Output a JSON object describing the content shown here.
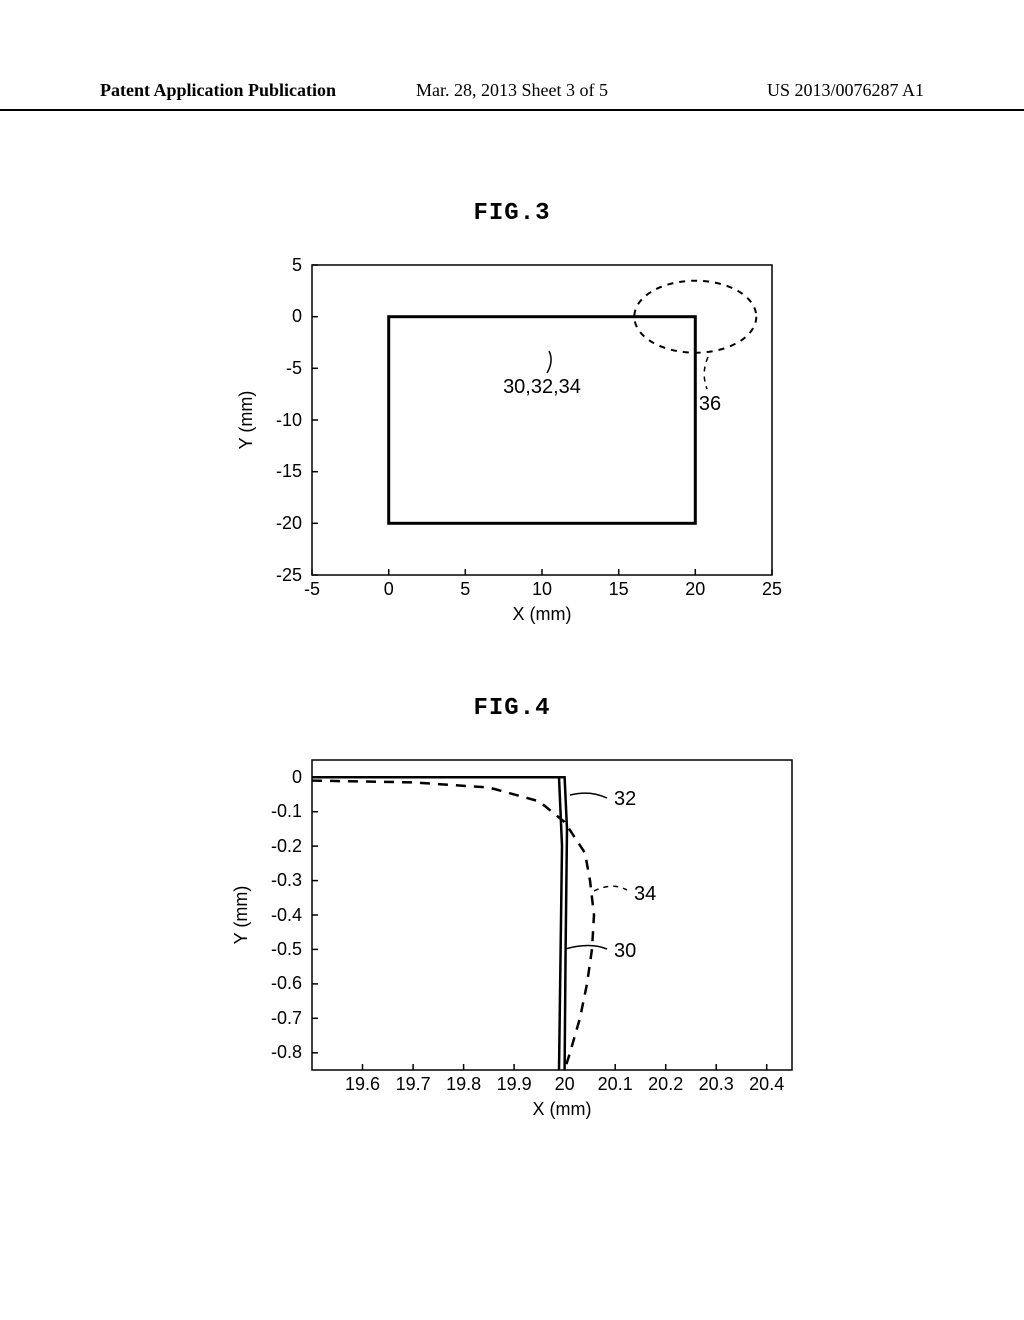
{
  "header": {
    "left": "Patent Application Publication",
    "center": "Mar. 28, 2013  Sheet 3 of 5",
    "right": "US 2013/0076287 A1"
  },
  "fig3": {
    "title": "FIG.3",
    "xlabel": "X (mm)",
    "ylabel": "Y (mm)",
    "xticks": [
      "-5",
      "0",
      "5",
      "10",
      "15",
      "20",
      "25"
    ],
    "yticks": [
      "5",
      "0",
      "-5",
      "-10",
      "-15",
      "-20",
      "-25"
    ],
    "annotation_30_32_34": "30,32,34",
    "annotation_36": "36"
  },
  "fig4": {
    "title": "FIG.4",
    "xlabel": "X (mm)",
    "ylabel": "Y (mm)",
    "xticks": [
      "19.6",
      "19.7",
      "19.8",
      "19.9",
      "20",
      "20.1",
      "20.2",
      "20.3",
      "20.4"
    ],
    "yticks": [
      "0",
      "-0.1",
      "-0.2",
      "-0.3",
      "-0.4",
      "-0.5",
      "-0.6",
      "-0.7",
      "-0.8"
    ],
    "annotation_32": "32",
    "annotation_34": "34",
    "annotation_30": "30"
  },
  "chart_data": [
    {
      "type": "line",
      "title": "FIG.3",
      "xlabel": "X (mm)",
      "ylabel": "Y (mm)",
      "xlim": [
        -5,
        25
      ],
      "ylim": [
        -25,
        5
      ],
      "xticks": [
        -5,
        0,
        5,
        10,
        15,
        20,
        25
      ],
      "yticks": [
        -25,
        -20,
        -15,
        -10,
        -5,
        0,
        5
      ],
      "series": [
        {
          "name": "30,32,34",
          "style": "solid",
          "points": [
            [
              0,
              0
            ],
            [
              20,
              0
            ],
            [
              20,
              -20
            ],
            [
              0,
              -20
            ],
            [
              0,
              0
            ]
          ]
        },
        {
          "name": "36",
          "style": "dashed-ellipse",
          "center": [
            20,
            0
          ],
          "rx": 4.0,
          "ry": 3.5
        }
      ],
      "annotations": [
        {
          "text": "30,32,34",
          "x": 10,
          "y": -5,
          "leader_to": [
            10.5,
            -2
          ]
        },
        {
          "text": "36",
          "x": 21,
          "y": -8,
          "leader_to": [
            21,
            -4
          ]
        }
      ]
    },
    {
      "type": "line",
      "title": "FIG.4",
      "xlabel": "X (mm)",
      "ylabel": "Y (mm)",
      "xlim": [
        19.5,
        20.45
      ],
      "ylim": [
        -0.85,
        0.05
      ],
      "xticks": [
        19.6,
        19.7,
        19.8,
        19.9,
        20,
        20.1,
        20.2,
        20.3,
        20.4
      ],
      "yticks": [
        0,
        -0.1,
        -0.2,
        -0.3,
        -0.4,
        -0.5,
        -0.6,
        -0.7,
        -0.8
      ],
      "series": [
        {
          "name": "30",
          "style": "solid",
          "points": [
            [
              19.5,
              0
            ],
            [
              19.99,
              0
            ],
            [
              19.995,
              -0.2
            ],
            [
              19.99,
              -0.85
            ]
          ]
        },
        {
          "name": "32",
          "style": "solid",
          "points": [
            [
              19.5,
              0
            ],
            [
              20.0,
              0
            ],
            [
              20.005,
              -0.15
            ],
            [
              20.002,
              -0.5
            ],
            [
              20.0,
              -0.85
            ]
          ]
        },
        {
          "name": "34",
          "style": "dashed",
          "points": [
            [
              19.5,
              -0.01
            ],
            [
              19.7,
              -0.015
            ],
            [
              19.85,
              -0.03
            ],
            [
              19.95,
              -0.07
            ],
            [
              20.0,
              -0.13
            ],
            [
              20.04,
              -0.22
            ],
            [
              20.05,
              -0.3
            ],
            [
              20.058,
              -0.4
            ],
            [
              20.055,
              -0.5
            ],
            [
              20.045,
              -0.6
            ],
            [
              20.03,
              -0.7
            ],
            [
              20.01,
              -0.8
            ],
            [
              20.0,
              -0.85
            ]
          ]
        }
      ],
      "annotations": [
        {
          "text": "32",
          "x": 20.12,
          "y": -0.07,
          "leader_to": [
            20.01,
            -0.05
          ]
        },
        {
          "text": "34",
          "x": 20.16,
          "y": -0.35,
          "leader_to": [
            20.055,
            -0.33
          ]
        },
        {
          "text": "30",
          "x": 20.12,
          "y": -0.5,
          "leader_to": [
            20.0,
            -0.5
          ]
        }
      ]
    }
  ]
}
